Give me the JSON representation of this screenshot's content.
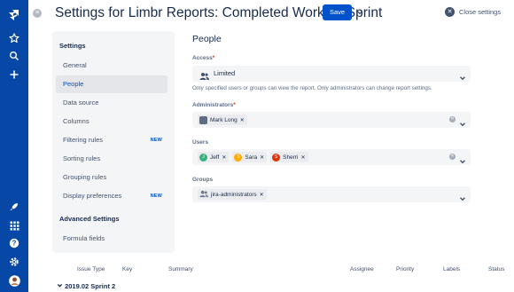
{
  "header": {
    "title": "Settings for Limbr Reports: Completed Work by Sprint",
    "save_label": "Save",
    "close_label": "Close settings"
  },
  "sidebar": {
    "settings_heading": "Settings",
    "items": [
      {
        "label": "General"
      },
      {
        "label": "People",
        "active": true
      },
      {
        "label": "Data source"
      },
      {
        "label": "Columns"
      },
      {
        "label": "Filtering rules",
        "badge": "NEW"
      },
      {
        "label": "Sorting rules"
      },
      {
        "label": "Grouping rules"
      },
      {
        "label": "Display preferences",
        "badge": "NEW"
      }
    ],
    "advanced_heading": "Advanced Settings",
    "advanced_items": [
      {
        "label": "Formula fields"
      }
    ]
  },
  "people": {
    "title": "People",
    "access": {
      "label": "Access",
      "required_mark": "*",
      "value": "Limited",
      "helper": "Only specified users or groups can view the report. Only administrators can change report settings."
    },
    "administrators": {
      "label": "Administrators",
      "required_mark": "*",
      "tags": [
        {
          "name": "Mark Long"
        }
      ]
    },
    "users": {
      "label": "Users",
      "tags": [
        {
          "name": "Jeff",
          "initial": "J",
          "color": "#36b37e"
        },
        {
          "name": "Sara",
          "initial": "S",
          "color": "#ffab00"
        },
        {
          "name": "Sherri",
          "initial": "S",
          "color": "#de350b"
        }
      ]
    },
    "groups": {
      "label": "Groups",
      "tags": [
        {
          "name": "jira-administrators"
        }
      ]
    }
  },
  "table": {
    "columns": [
      "Issue Type",
      "Key",
      "Summary",
      "Assignee",
      "Priority",
      "Labels",
      "Status"
    ],
    "group": "2019.02 Sprint 2"
  },
  "colors": {
    "nav": "#0747a6",
    "accent": "#0052cc",
    "panel": "#f4f5f7"
  },
  "icons": {
    "nav_top": [
      "jira-logo-icon",
      "star-icon",
      "search-icon",
      "plus-icon"
    ],
    "nav_bottom": [
      "rocket-icon",
      "apps-grid-icon",
      "help-icon",
      "settings-icon",
      "avatar"
    ]
  }
}
